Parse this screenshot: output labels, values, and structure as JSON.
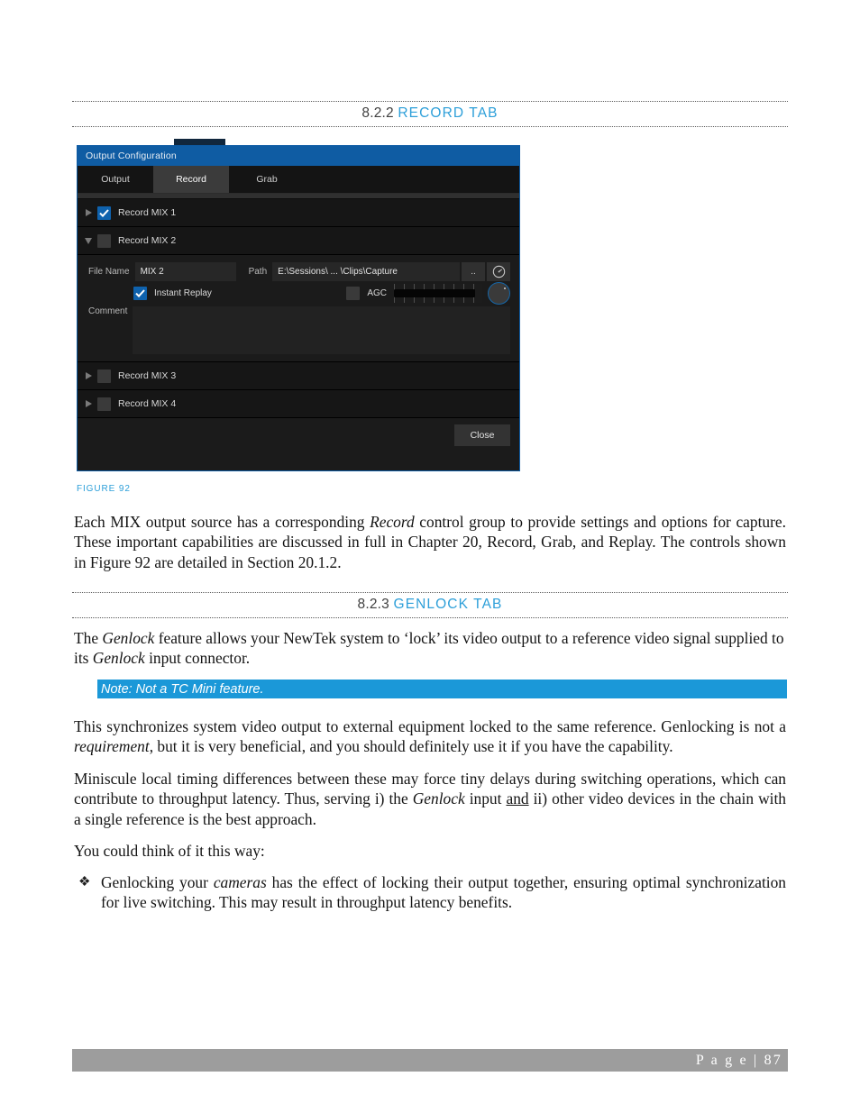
{
  "headings": {
    "record_tab": {
      "number": "8.2.2",
      "title": "RECORD  TAB"
    },
    "genlock_tab": {
      "number": "8.2.3",
      "title": "GENLOCK TAB"
    }
  },
  "figure": {
    "caption": "FIGURE 92",
    "window": {
      "title": "Output Configuration",
      "tabs": [
        {
          "label": "Output",
          "active": false
        },
        {
          "label": "Record",
          "active": true
        },
        {
          "label": "Grab",
          "active": false
        }
      ],
      "mix_rows": [
        {
          "label": "Record MIX 1",
          "checked": true,
          "expanded": false
        },
        {
          "label": "Record MIX 2",
          "checked": false,
          "expanded": true
        },
        {
          "label": "Record MIX 3",
          "checked": false,
          "expanded": false
        },
        {
          "label": "Record MIX 4",
          "checked": false,
          "expanded": false
        }
      ],
      "detail": {
        "file_name_label": "File Name",
        "file_name_value": "MIX 2",
        "path_label": "Path",
        "path_value": "E:\\Sessions\\ ... \\Clips\\Capture",
        "browse_label": "..",
        "gauge_icon": "gauge-icon",
        "instant_replay_label": "Instant Replay",
        "instant_replay_checked": true,
        "agc_label": "AGC",
        "agc_checked": false,
        "comment_label": "Comment",
        "comment_value": ""
      },
      "close_label": "Close"
    }
  },
  "body": {
    "p1_a": "Each MIX output source has a corresponding ",
    "p1_i": "Record",
    "p1_b": " control group to provide settings and options for capture.   These important capabilities are discussed in full in Chapter 20, Record, Grab, and Replay.  The controls shown in Figure 92 are detailed in Section 20.1.2.",
    "p2_a": "The ",
    "p2_i1": "Genlock",
    "p2_b": " feature allows your NewTek system to ‘lock’ its video output to a reference video signal supplied to its ",
    "p2_i2": "Genlock",
    "p2_c": " input connector.",
    "note": "Note: Not a TC Mini feature.",
    "p3_a": "This synchronizes system video output to external equipment locked to the same reference.  Genlocking is not a ",
    "p3_i": "requirement",
    "p3_b": ", but it is very beneficial, and you should definitely use it if you have the capability.",
    "p4_a": "Miniscule local timing differences between these may force tiny delays during switching operations, which can contribute to throughput latency. Thus, serving i) the ",
    "p4_i": "Genlock",
    "p4_b": " input ",
    "p4_u": "and",
    "p4_c": " ii) other video devices in the chain with a single reference is the best approach.",
    "p5": "You could think of it this way:",
    "bullet_glyph": "❖",
    "b1_a": "Genlocking your ",
    "b1_i": "cameras",
    "b1_b": " has the effect of locking their output together, ensuring optimal synchronization for live switching.  This may result in throughput latency benefits."
  },
  "footer": {
    "page_label": "P a g e  | 87"
  },
  "colors": {
    "heading_blue": "#2d9fd9",
    "note_blue": "#1b98d8",
    "titlebar_blue": "#0f5ca3",
    "footer_gray": "#9d9d9d"
  }
}
